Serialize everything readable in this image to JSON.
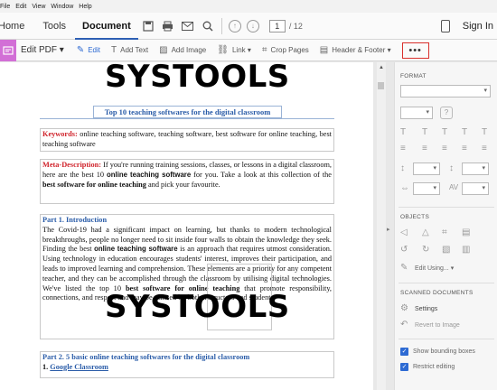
{
  "menubar": {
    "items": [
      "File",
      "Edit",
      "View",
      "Window",
      "Help"
    ]
  },
  "tabs": {
    "home": "Home",
    "tools": "Tools",
    "document": "Document"
  },
  "pager": {
    "current": "1",
    "total": "/ 12"
  },
  "account": {
    "signin": "Sign In"
  },
  "edit_toolbar": {
    "edit_pdf": "Edit PDF",
    "edit": "Edit",
    "add_text": "Add Text",
    "add_image": "Add Image",
    "link": "Link",
    "crop_pages": "Crop Pages",
    "header_footer": "Header & Footer",
    "more": "•••"
  },
  "document": {
    "logo_top": "SYSTOOLS",
    "logo_mid": "SYSTOOLS",
    "title": "Top 10 teaching softwares for the digital classroom",
    "keywords_label": "Keywords:",
    "keywords_text": " online teaching software, teaching software, best software for online teaching, best teaching software",
    "meta_label": "Meta-Description:",
    "meta_text_1": " If you're running training sessions, classes, or lessons in a digital classroom, here are the best 10 ",
    "meta_bold_1": "online teaching software",
    "meta_text_2": " for you. Take a look at this collection of the ",
    "meta_bold_2": "best software for online teaching",
    "meta_text_3": " and pick your favourite.",
    "part1_heading": "Part 1. Introduction",
    "part1_text_1": "The Covid-19 had a significant impact on learning, but thanks to modern technological breakthroughs, people no longer need to sit inside four walls to obtain the knowledge they seek. Finding the best ",
    "part1_bold_1": "online teaching software",
    "part1_text_2": " is an approach that requires utmost consideration. Using technology in education encourages students' interest, improves their participation, and leads to improved learning and comprehension. These elements are a priority for any competent teacher, and they can be accomplished through the classroom by utilising digital technologies. We've listed the top 10 ",
    "part1_bold_2": "best software for online teaching",
    "part1_text_3": " that promote responsibility, connections, and respect and may be utilised by both instructors and students.",
    "part2_heading": "Part 2. 5 basic online teaching softwares for the digital classroom",
    "part2_item": "1. ",
    "part2_link": "Google Classroom"
  },
  "right_panel": {
    "format_label": "FORMAT",
    "objects_label": "OBJECTS",
    "edit_using": "Edit Using...",
    "scanned_label": "SCANNED DOCUMENTS",
    "settings": "Settings",
    "revert": "Revert to Image",
    "show_boxes": "Show bounding boxes",
    "restrict": "Restrict editing"
  },
  "colors": {
    "accent_blue": "#2d6ad3",
    "edit_pdf_pink": "#d26fd6",
    "highlight_red": "#d9302c",
    "keyword_red": "#d0232b",
    "heading_blue": "#2a5ca8"
  }
}
